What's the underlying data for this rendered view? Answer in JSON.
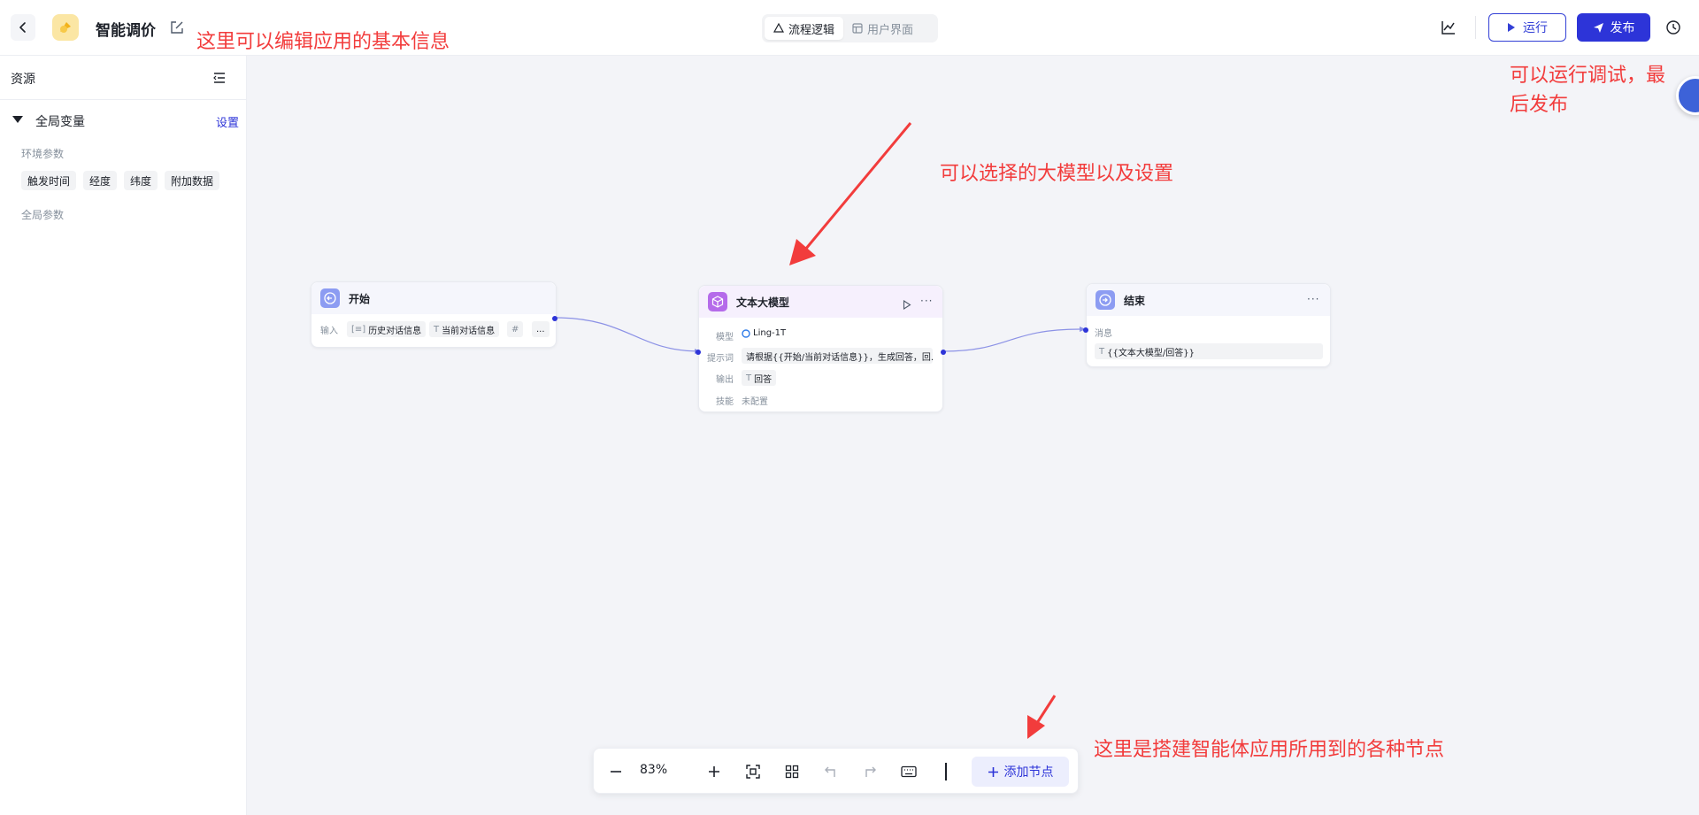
{
  "header": {
    "app_title": "智能调价",
    "tabs": [
      {
        "label": "流程逻辑",
        "active": true
      },
      {
        "label": "用户界面",
        "active": false
      }
    ],
    "run_label": "运行",
    "publish_label": "发布"
  },
  "sidebar": {
    "title": "资源",
    "global_vars_label": "全局变量",
    "settings_label": "设置",
    "env_params_label": "环境参数",
    "env_chips": [
      "触发时间",
      "经度",
      "纬度",
      "附加数据"
    ],
    "global_params_label": "全局参数"
  },
  "nodes": {
    "start": {
      "title": "开始",
      "input_label": "输入",
      "inputs": [
        "历史对话信息",
        "当前对话信息",
        "#",
        "..."
      ]
    },
    "llm": {
      "title": "文本大模型",
      "model_label": "模型",
      "model_value": "Ling-1T",
      "prompt_label": "提示词",
      "prompt_value": "请根据{{开始/当前对话信息}}，生成回答，回...",
      "output_label": "输出",
      "output_value": "回答",
      "skill_label": "技能",
      "skill_value": "未配置"
    },
    "end": {
      "title": "结束",
      "message_label": "消息",
      "message_value": "{{文本大模型/回答}}"
    }
  },
  "toolbar": {
    "zoom": "83%",
    "add_node_label": "添加节点"
  },
  "annotations": {
    "edit_info": "这里可以编辑应用的基本信息",
    "run_publish_line1": "可以运行调试，最",
    "run_publish_line2": "后发布",
    "model_select": "可以选择的大模型以及设置",
    "nodes_hint": "这里是搭建智能体应用所用到的各种节点"
  },
  "colors": {
    "accent": "#2d34d8",
    "annotation": "#f23c3c",
    "canvas": "#f3f4f8"
  }
}
